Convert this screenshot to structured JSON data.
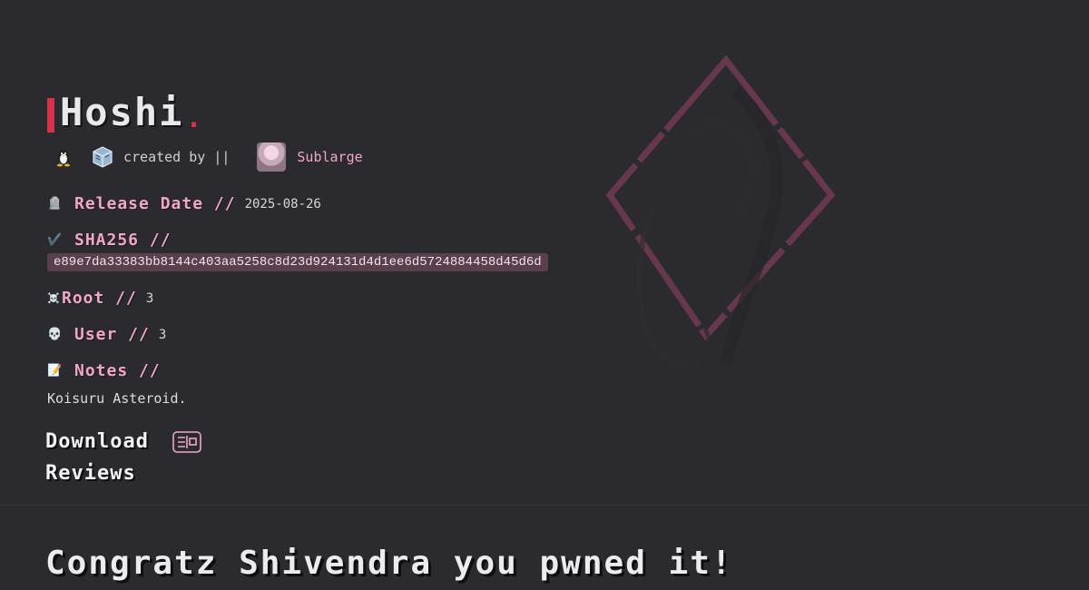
{
  "machine": {
    "title": "Hoshi",
    "title_dot": ".",
    "created_by_label": "created by ||",
    "creator_name": "Sublarge"
  },
  "icons": {
    "os": "linux-penguin-icon",
    "platform": "virtualbox-icon",
    "release": "tombstone-icon",
    "sha": "checkmark-icon",
    "root": "skull-crossbones-icon",
    "user": "skull-icon",
    "notes": "memo-icon",
    "download": "card-icon"
  },
  "fields": {
    "release_label": "Release Date //",
    "release_value": "2025-08-26",
    "sha_label": "SHA256 //",
    "sha_value": "e89e7da33383bb8144c403aa5258c8d23d924131d4d1ee6d5724884458d45d6d",
    "root_label": "Root //",
    "root_value": "3",
    "user_label": "User //",
    "user_value": "3",
    "notes_label": "Notes //",
    "notes_value": "Koisuru Asteroid."
  },
  "links": {
    "download": "Download",
    "reviews": "Reviews"
  },
  "congrats": "Congratz Shivendra you pwned it!",
  "colors": {
    "background": "#2a2a2f",
    "accent_red": "#d6324b",
    "accent_pink": "#f2a7c9",
    "hash_bg": "#5a3f4c"
  }
}
